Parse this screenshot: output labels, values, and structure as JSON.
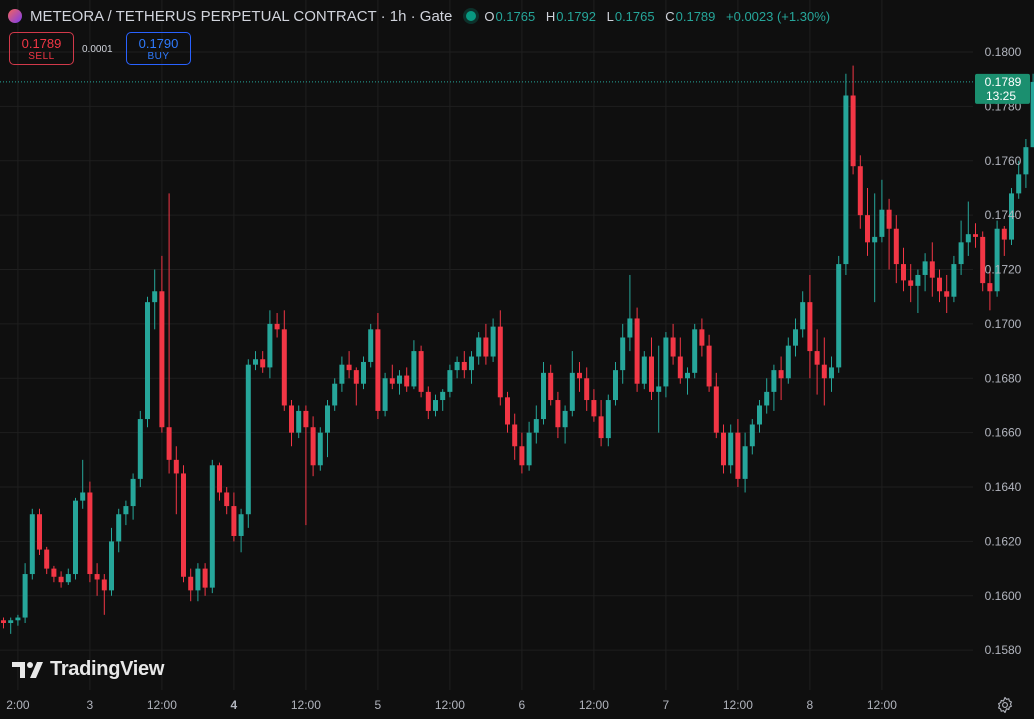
{
  "header": {
    "symbol": "METEORA / TETHERUS PERPETUAL CONTRACT · 1h · Gate",
    "ohlc": [
      {
        "key": "O",
        "value": "0.1765"
      },
      {
        "key": "H",
        "value": "0.1792"
      },
      {
        "key": "L",
        "value": "0.1765"
      },
      {
        "key": "C",
        "value": "0.1789"
      },
      {
        "key": "",
        "value": "+0.0023 (+1.30%)"
      }
    ]
  },
  "trade": {
    "sell_price": "0.1789",
    "sell_label": "SELL",
    "spread": "0.0001",
    "buy_price": "0.1790",
    "buy_label": "BUY"
  },
  "price_label": {
    "price": "0.1789",
    "countdown": "13:25"
  },
  "logo_text": "TradingView",
  "colors": {
    "up": "#26a69a",
    "down": "#f23645",
    "background": "#0f0f0f",
    "grid": "#1f1f1f"
  },
  "icons": [
    "settings-gear-icon",
    "tradingview-logo-icon",
    "symbol-icon",
    "market-status-icon"
  ],
  "chart_data": {
    "type": "candlestick",
    "timeframe": "1h",
    "ylim": [
      0.157,
      0.1805
    ],
    "y_ticks": [
      "0.1800",
      "0.1780",
      "0.1760",
      "0.1740",
      "0.1720",
      "0.1700",
      "0.1680",
      "0.1660",
      "0.1640",
      "0.1620",
      "0.1600",
      "0.1580"
    ],
    "x_ticks": [
      {
        "label": "2:00",
        "bar": 2,
        "bold": false
      },
      {
        "label": "3",
        "bar": 12,
        "bold": false
      },
      {
        "label": "12:00",
        "bar": 22,
        "bold": false
      },
      {
        "label": "4",
        "bar": 32,
        "bold": true
      },
      {
        "label": "12:00",
        "bar": 42,
        "bold": false
      },
      {
        "label": "5",
        "bar": 52,
        "bold": false
      },
      {
        "label": "12:00",
        "bar": 62,
        "bold": false
      },
      {
        "label": "6",
        "bar": 72,
        "bold": false
      },
      {
        "label": "12:00",
        "bar": 82,
        "bold": false
      },
      {
        "label": "7",
        "bar": 92,
        "bold": false
      },
      {
        "label": "12:00",
        "bar": 102,
        "bold": false
      },
      {
        "label": "8",
        "bar": 112,
        "bold": false
      },
      {
        "label": "12:00",
        "bar": 122,
        "bold": false
      }
    ],
    "last_price": 0.1789,
    "candles": [
      [
        0.1591,
        0.1592,
        0.1588,
        0.159
      ],
      [
        0.159,
        0.1592,
        0.1586,
        0.1591
      ],
      [
        0.1591,
        0.1593,
        0.1589,
        0.1592
      ],
      [
        0.1592,
        0.1612,
        0.159,
        0.1608
      ],
      [
        0.1608,
        0.1632,
        0.1606,
        0.163
      ],
      [
        0.163,
        0.1632,
        0.1615,
        0.1617
      ],
      [
        0.1617,
        0.1618,
        0.1608,
        0.161
      ],
      [
        0.161,
        0.1611,
        0.1605,
        0.1607
      ],
      [
        0.1607,
        0.1609,
        0.1603,
        0.1605
      ],
      [
        0.1605,
        0.161,
        0.1604,
        0.1608
      ],
      [
        0.1608,
        0.1636,
        0.1606,
        0.1635
      ],
      [
        0.1635,
        0.165,
        0.1632,
        0.1638
      ],
      [
        0.1638,
        0.1642,
        0.1605,
        0.1608
      ],
      [
        0.1608,
        0.1612,
        0.16,
        0.1606
      ],
      [
        0.1606,
        0.1608,
        0.1593,
        0.1602
      ],
      [
        0.1602,
        0.1625,
        0.16,
        0.162
      ],
      [
        0.162,
        0.1632,
        0.1616,
        0.163
      ],
      [
        0.163,
        0.1635,
        0.1626,
        0.1633
      ],
      [
        0.1633,
        0.1645,
        0.1628,
        0.1643
      ],
      [
        0.1643,
        0.1668,
        0.164,
        0.1665
      ],
      [
        0.1665,
        0.171,
        0.1662,
        0.1708
      ],
      [
        0.1708,
        0.172,
        0.1698,
        0.1712
      ],
      [
        0.1712,
        0.1725,
        0.166,
        0.1662
      ],
      [
        0.1662,
        0.1748,
        0.1645,
        0.165
      ],
      [
        0.165,
        0.1655,
        0.163,
        0.1645
      ],
      [
        0.1645,
        0.1648,
        0.1605,
        0.1607
      ],
      [
        0.1607,
        0.161,
        0.1598,
        0.1602
      ],
      [
        0.1602,
        0.1612,
        0.1598,
        0.161
      ],
      [
        0.161,
        0.1612,
        0.16,
        0.1603
      ],
      [
        0.1603,
        0.165,
        0.1601,
        0.1648
      ],
      [
        0.1648,
        0.1649,
        0.1635,
        0.1638
      ],
      [
        0.1638,
        0.164,
        0.163,
        0.1633
      ],
      [
        0.1633,
        0.1638,
        0.162,
        0.1622
      ],
      [
        0.1622,
        0.1632,
        0.1616,
        0.163
      ],
      [
        0.163,
        0.1687,
        0.1625,
        0.1685
      ],
      [
        0.1685,
        0.169,
        0.1683,
        0.1687
      ],
      [
        0.1687,
        0.169,
        0.1682,
        0.1684
      ],
      [
        0.1684,
        0.1705,
        0.168,
        0.17
      ],
      [
        0.17,
        0.1704,
        0.1695,
        0.1698
      ],
      [
        0.1698,
        0.1705,
        0.1668,
        0.167
      ],
      [
        0.167,
        0.1672,
        0.1655,
        0.166
      ],
      [
        0.166,
        0.167,
        0.1658,
        0.1668
      ],
      [
        0.1668,
        0.167,
        0.1626,
        0.1662
      ],
      [
        0.1662,
        0.1666,
        0.1644,
        0.1648
      ],
      [
        0.1648,
        0.1662,
        0.1646,
        0.166
      ],
      [
        0.166,
        0.1672,
        0.1651,
        0.167
      ],
      [
        0.167,
        0.168,
        0.1668,
        0.1678
      ],
      [
        0.1678,
        0.1688,
        0.1675,
        0.1685
      ],
      [
        0.1685,
        0.169,
        0.168,
        0.1683
      ],
      [
        0.1683,
        0.1684,
        0.167,
        0.1678
      ],
      [
        0.1678,
        0.1688,
        0.1676,
        0.1686
      ],
      [
        0.1686,
        0.17,
        0.1684,
        0.1698
      ],
      [
        0.1698,
        0.1704,
        0.1665,
        0.1668
      ],
      [
        0.1668,
        0.1682,
        0.1666,
        0.168
      ],
      [
        0.168,
        0.1685,
        0.1676,
        0.1678
      ],
      [
        0.1678,
        0.1683,
        0.1674,
        0.1681
      ],
      [
        0.1681,
        0.1684,
        0.1675,
        0.1677
      ],
      [
        0.1677,
        0.1694,
        0.1676,
        0.169
      ],
      [
        0.169,
        0.1692,
        0.1673,
        0.1675
      ],
      [
        0.1675,
        0.1677,
        0.1665,
        0.1668
      ],
      [
        0.1668,
        0.1674,
        0.1666,
        0.1672
      ],
      [
        0.1672,
        0.1676,
        0.1668,
        0.1675
      ],
      [
        0.1675,
        0.1685,
        0.1673,
        0.1683
      ],
      [
        0.1683,
        0.1688,
        0.168,
        0.1686
      ],
      [
        0.1686,
        0.169,
        0.168,
        0.1683
      ],
      [
        0.1683,
        0.169,
        0.1678,
        0.1688
      ],
      [
        0.1688,
        0.1697,
        0.1685,
        0.1695
      ],
      [
        0.1695,
        0.17,
        0.1685,
        0.1688
      ],
      [
        0.1688,
        0.1702,
        0.1686,
        0.1699
      ],
      [
        0.1699,
        0.1705,
        0.167,
        0.1673
      ],
      [
        0.1673,
        0.1675,
        0.166,
        0.1663
      ],
      [
        0.1663,
        0.1667,
        0.165,
        0.1655
      ],
      [
        0.1655,
        0.166,
        0.1645,
        0.1648
      ],
      [
        0.1648,
        0.1664,
        0.1646,
        0.166
      ],
      [
        0.166,
        0.167,
        0.1656,
        0.1665
      ],
      [
        0.1665,
        0.1686,
        0.1663,
        0.1682
      ],
      [
        0.1682,
        0.1685,
        0.167,
        0.1672
      ],
      [
        0.1672,
        0.1675,
        0.1658,
        0.1662
      ],
      [
        0.1662,
        0.167,
        0.1656,
        0.1668
      ],
      [
        0.1668,
        0.169,
        0.1666,
        0.1682
      ],
      [
        0.1682,
        0.1686,
        0.1675,
        0.168
      ],
      [
        0.168,
        0.1684,
        0.1668,
        0.1672
      ],
      [
        0.1672,
        0.1676,
        0.1664,
        0.1666
      ],
      [
        0.1666,
        0.1672,
        0.1655,
        0.1658
      ],
      [
        0.1658,
        0.1674,
        0.1655,
        0.1672
      ],
      [
        0.1672,
        0.1686,
        0.167,
        0.1683
      ],
      [
        0.1683,
        0.17,
        0.1678,
        0.1695
      ],
      [
        0.1695,
        0.1718,
        0.169,
        0.1702
      ],
      [
        0.1702,
        0.1706,
        0.1675,
        0.1678
      ],
      [
        0.1678,
        0.169,
        0.1676,
        0.1688
      ],
      [
        0.1688,
        0.1695,
        0.1672,
        0.1675
      ],
      [
        0.1675,
        0.1692,
        0.166,
        0.1677
      ],
      [
        0.1677,
        0.1697,
        0.1673,
        0.1695
      ],
      [
        0.1695,
        0.17,
        0.1685,
        0.1688
      ],
      [
        0.1688,
        0.1695,
        0.1678,
        0.168
      ],
      [
        0.168,
        0.1684,
        0.1674,
        0.1682
      ],
      [
        0.1682,
        0.17,
        0.168,
        0.1698
      ],
      [
        0.1698,
        0.1702,
        0.1688,
        0.1692
      ],
      [
        0.1692,
        0.1696,
        0.1675,
        0.1677
      ],
      [
        0.1677,
        0.1682,
        0.1658,
        0.166
      ],
      [
        0.166,
        0.1663,
        0.1645,
        0.1648
      ],
      [
        0.1648,
        0.1663,
        0.1645,
        0.166
      ],
      [
        0.166,
        0.1665,
        0.164,
        0.1643
      ],
      [
        0.1643,
        0.166,
        0.1638,
        0.1655
      ],
      [
        0.1655,
        0.1665,
        0.1652,
        0.1663
      ],
      [
        0.1663,
        0.1672,
        0.166,
        0.167
      ],
      [
        0.167,
        0.168,
        0.1667,
        0.1675
      ],
      [
        0.1675,
        0.1685,
        0.1668,
        0.1683
      ],
      [
        0.1683,
        0.1688,
        0.1672,
        0.168
      ],
      [
        0.168,
        0.1695,
        0.1678,
        0.1692
      ],
      [
        0.1692,
        0.1702,
        0.1688,
        0.1698
      ],
      [
        0.1698,
        0.1712,
        0.1695,
        0.1708
      ],
      [
        0.1708,
        0.1718,
        0.168,
        0.169
      ],
      [
        0.169,
        0.1698,
        0.1674,
        0.1685
      ],
      [
        0.1685,
        0.1695,
        0.167,
        0.168
      ],
      [
        0.168,
        0.1688,
        0.1675,
        0.1684
      ],
      [
        0.1684,
        0.1725,
        0.1682,
        0.1722
      ],
      [
        0.1722,
        0.1792,
        0.1718,
        0.1784
      ],
      [
        0.1784,
        0.1795,
        0.1755,
        0.1758
      ],
      [
        0.1758,
        0.1762,
        0.1735,
        0.174
      ],
      [
        0.174,
        0.175,
        0.1725,
        0.173
      ],
      [
        0.173,
        0.1748,
        0.1708,
        0.1732
      ],
      [
        0.1732,
        0.1753,
        0.173,
        0.1742
      ],
      [
        0.1742,
        0.1746,
        0.172,
        0.1735
      ],
      [
        0.1735,
        0.174,
        0.1715,
        0.1722
      ],
      [
        0.1722,
        0.1728,
        0.1712,
        0.1716
      ],
      [
        0.1716,
        0.1722,
        0.1708,
        0.1714
      ],
      [
        0.1714,
        0.172,
        0.1704,
        0.1718
      ],
      [
        0.1718,
        0.1726,
        0.1712,
        0.1723
      ],
      [
        0.1723,
        0.173,
        0.171,
        0.1717
      ],
      [
        0.1717,
        0.172,
        0.1708,
        0.1712
      ],
      [
        0.1712,
        0.1718,
        0.1704,
        0.171
      ],
      [
        0.171,
        0.1725,
        0.1708,
        0.1722
      ],
      [
        0.1722,
        0.1738,
        0.1718,
        0.173
      ],
      [
        0.173,
        0.1745,
        0.1725,
        0.1733
      ],
      [
        0.1733,
        0.1737,
        0.1728,
        0.1732
      ],
      [
        0.1732,
        0.1734,
        0.1712,
        0.1715
      ],
      [
        0.1715,
        0.172,
        0.1705,
        0.1712
      ],
      [
        0.1712,
        0.1738,
        0.171,
        0.1735
      ],
      [
        0.1735,
        0.1736,
        0.1725,
        0.1731
      ],
      [
        0.1731,
        0.175,
        0.1729,
        0.1748
      ],
      [
        0.1748,
        0.176,
        0.1746,
        0.1755
      ],
      [
        0.1755,
        0.1768,
        0.175,
        0.1765
      ],
      [
        0.1765,
        0.1792,
        0.1765,
        0.1789
      ]
    ]
  }
}
